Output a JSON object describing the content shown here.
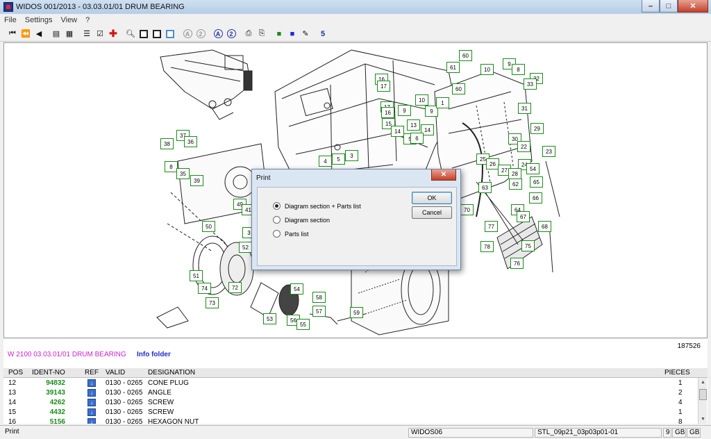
{
  "window": {
    "title": "WIDOS 001/2013 - 03.03.01/01 DRUM BEARING",
    "min": "–",
    "max": "□",
    "close": "✕"
  },
  "menu": [
    "File",
    "Settings",
    "View",
    "?"
  ],
  "toolbar": {
    "icons": [
      "first-icon",
      "rewind-icon",
      "prev-icon",
      "doc-nav-icon",
      "doc-nav2-icon",
      "list-icon",
      "checklist-icon",
      "add-cross-icon",
      "zoom-icon",
      "page-icon",
      "page-fit-icon",
      "frame-icon",
      "zoom-a-icon",
      "zoom-2-icon",
      "info-a-icon",
      "info-2-icon",
      "print-icon",
      "print-preview-icon",
      "export-icon",
      "select-icon",
      "eraser-icon",
      "widos-icon"
    ]
  },
  "callouts": [
    "60",
    "61",
    "60",
    "9",
    "10",
    "8",
    "32",
    "33",
    "16",
    "17",
    "17",
    "16",
    "9",
    "10",
    "9",
    "1",
    "31",
    "15",
    "14",
    "13",
    "14",
    "29",
    "5",
    "6",
    "30",
    "22",
    "23",
    "37",
    "38",
    "36",
    "8",
    "35",
    "39",
    "4",
    "5",
    "3",
    "25",
    "26",
    "27",
    "24",
    "54",
    "28",
    "62",
    "65",
    "63",
    "66",
    "70",
    "64",
    "67",
    "68",
    "77",
    "78",
    "75",
    "76",
    "49",
    "41",
    "50",
    "3",
    "52",
    "51",
    "74",
    "72",
    "73",
    "54",
    "58",
    "57",
    "59",
    "53",
    "56",
    "55"
  ],
  "dialog": {
    "title": "Print",
    "close": "✕",
    "options": [
      {
        "label": "Diagram section + Parts list",
        "checked": true
      },
      {
        "label": "Diagram section",
        "checked": false
      },
      {
        "label": "Parts list",
        "checked": false
      }
    ],
    "ok": "OK",
    "cancel": "Cancel"
  },
  "info": {
    "ref_number": "187526",
    "title": "W 2100 03.03.01/01 DRUM BEARING",
    "folder": "Info folder"
  },
  "parts": {
    "headers": {
      "pos": "POS",
      "ident": "IDENT-NO",
      "ref": "REF",
      "valid": "VALID",
      "designation": "DESIGNATION",
      "pieces": "PIECES"
    },
    "rows": [
      {
        "pos": "12",
        "ident": "94832",
        "valid": "0130 - 0265",
        "designation": "CONE PLUG",
        "pieces": "1"
      },
      {
        "pos": "13",
        "ident": "39143",
        "valid": "0130 - 0265",
        "designation": "ANGLE",
        "pieces": "2"
      },
      {
        "pos": "14",
        "ident": "4262",
        "valid": "0130 - 0265",
        "designation": "SCREW",
        "pieces": "4"
      },
      {
        "pos": "15",
        "ident": "4432",
        "valid": "0130 - 0265",
        "designation": "SCREW",
        "pieces": "1"
      },
      {
        "pos": "16",
        "ident": "5156",
        "valid": "0130 - 0265",
        "designation": "HEXAGON NUT",
        "pieces": "8"
      }
    ],
    "ref_icon": "↓"
  },
  "status": {
    "left": "Print",
    "app": "WIDOS06",
    "file": "STL_09p21_03p03p01-01",
    "page": "9",
    "lang1": "GB",
    "lang2": "GB"
  }
}
